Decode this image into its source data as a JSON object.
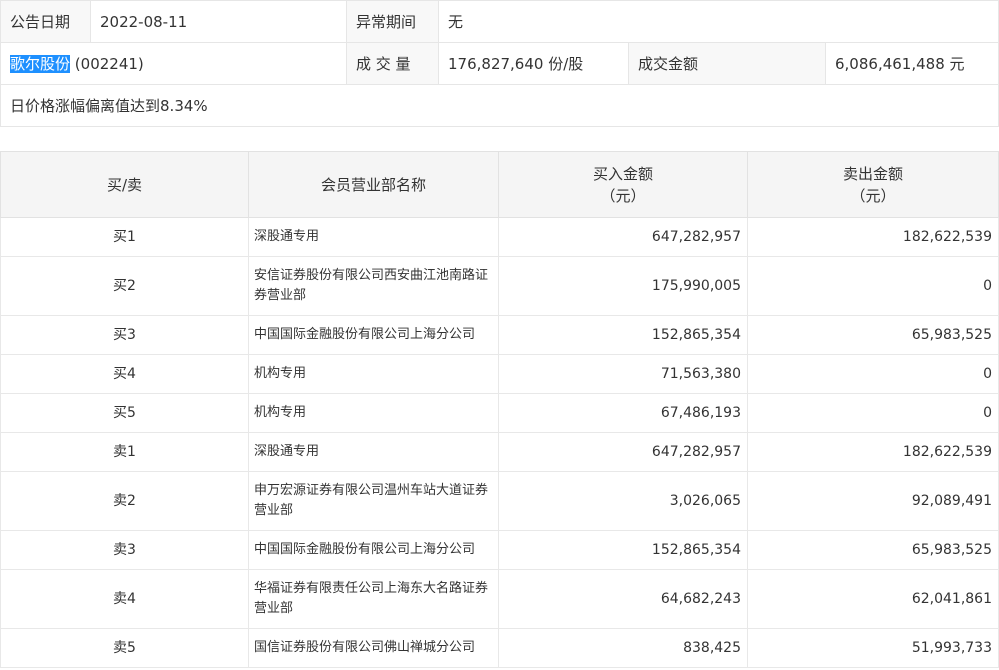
{
  "header": {
    "announce_date_label": "公告日期",
    "announce_date": "2022-08-11",
    "abnormal_period_label": "异常期间",
    "abnormal_period": "无",
    "stock_name": "歌尔股份",
    "stock_code": "(002241)",
    "volume_label": "成 交 量",
    "volume": "176,827,640 份/股",
    "amount_label": "成交金额",
    "amount": "6,086,461,488 元",
    "reason": "日价格涨幅偏离值达到8.34%"
  },
  "table": {
    "columns": {
      "direction": "买/卖",
      "branch": "会员营业部名称",
      "buy": "买入金额",
      "buy_unit": "（元）",
      "sell": "卖出金额",
      "sell_unit": "（元）"
    },
    "rows": [
      {
        "dir": "买1",
        "name": "深股通专用",
        "buy": "647,282,957",
        "sell": "182,622,539"
      },
      {
        "dir": "买2",
        "name": "安信证券股份有限公司西安曲江池南路证券营业部",
        "buy": "175,990,005",
        "sell": "0"
      },
      {
        "dir": "买3",
        "name": "中国国际金融股份有限公司上海分公司",
        "buy": "152,865,354",
        "sell": "65,983,525"
      },
      {
        "dir": "买4",
        "name": "机构专用",
        "buy": "71,563,380",
        "sell": "0"
      },
      {
        "dir": "买5",
        "name": "机构专用",
        "buy": "67,486,193",
        "sell": "0"
      },
      {
        "dir": "卖1",
        "name": "深股通专用",
        "buy": "647,282,957",
        "sell": "182,622,539"
      },
      {
        "dir": "卖2",
        "name": "申万宏源证券有限公司温州车站大道证券营业部",
        "buy": "3,026,065",
        "sell": "92,089,491"
      },
      {
        "dir": "卖3",
        "name": "中国国际金融股份有限公司上海分公司",
        "buy": "152,865,354",
        "sell": "65,983,525"
      },
      {
        "dir": "卖4",
        "name": "华福证券有限责任公司上海东大名路证券营业部",
        "buy": "64,682,243",
        "sell": "62,041,861"
      },
      {
        "dir": "卖5",
        "name": "国信证券股份有限公司佛山禅城分公司",
        "buy": "838,425",
        "sell": "51,993,733"
      }
    ]
  },
  "colors": {
    "highlight": "#1e90ff",
    "header_bg": "#f5f5f5",
    "border": "#e6e6e6"
  }
}
